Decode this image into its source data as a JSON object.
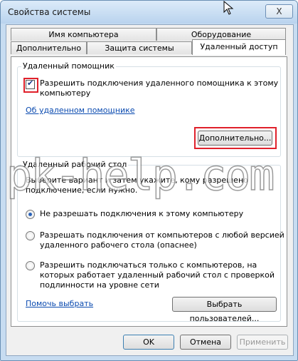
{
  "window": {
    "title": "Свойства системы",
    "close_label": "X"
  },
  "tabs": {
    "row1": [
      {
        "label": "Имя компьютера"
      },
      {
        "label": "Оборудование"
      }
    ],
    "row2": [
      {
        "label": "Дополнительно"
      },
      {
        "label": "Защита системы"
      },
      {
        "label": "Удаленный доступ"
      }
    ]
  },
  "remote_assistance": {
    "group_title": "Удаленный помощник",
    "allow_checkbox": {
      "label_line1": "Разрешить подключения удаленного помощника к этому",
      "label_line2": "компьютеру",
      "checked": true
    },
    "about_link": "Об удаленном помощнике",
    "advanced_button": "Дополнительно..."
  },
  "remote_desktop": {
    "group_title": "Удаленный рабочий стол",
    "instructions_line1": "Выберите вариант и затем укажите, кому разрешено",
    "instructions_line2": "подключение, если нужно.",
    "options": [
      {
        "line1": "Не разрешать подключения к этому компьютеру",
        "line2": "",
        "line3": "",
        "selected": true
      },
      {
        "line1": "Разрешать подключения от компьютеров с любой версией",
        "line2": "удаленного рабочего стола (опаснее)",
        "line3": "",
        "selected": false
      },
      {
        "line1": "Разрешить подключаться только с компьютеров, на",
        "line2": "которых работает удаленный рабочий стол с проверкой",
        "line3": "подлинности на уровне сети",
        "selected": false
      }
    ],
    "help_link": "Помочь выбрать",
    "select_users_button": "Выбрать пользователей..."
  },
  "footer": {
    "ok_label": "OK",
    "cancel_label": "Отмена",
    "apply_label": "Применить"
  },
  "watermark": "pk-help.com",
  "colors": {
    "highlight": "#e0212b",
    "link": "#0b4bb0",
    "selected_radio": "#2a62b8"
  }
}
